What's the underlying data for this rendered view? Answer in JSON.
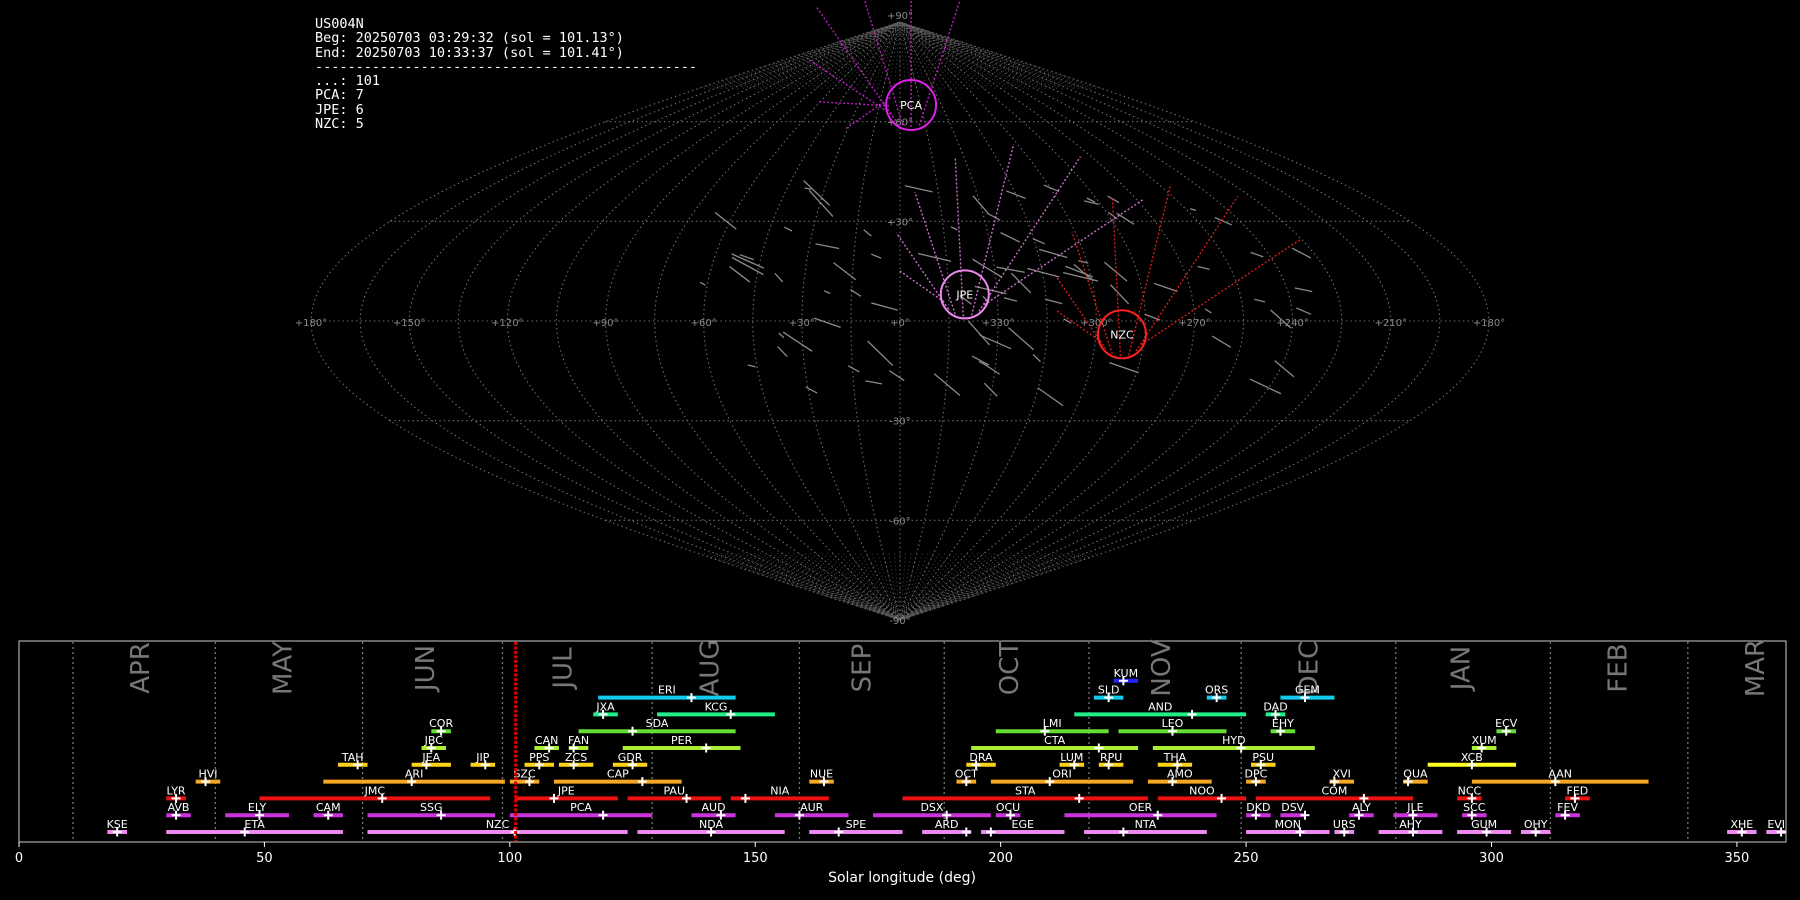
{
  "header": {
    "station": "US004N",
    "begin": "Beg: 20250703 03:29:32 (sol = 101.13°)",
    "end": "End: 20250703 10:33:37 (sol = 101.41°)",
    "separator": "-----------------------------------------------",
    "counts": [
      {
        "label": "...:",
        "value": "101"
      },
      {
        "label": "PCA:",
        "value": "7"
      },
      {
        "label": "JPE:",
        "value": "6"
      },
      {
        "label": "NZC:",
        "value": "5"
      }
    ]
  },
  "sky_map": {
    "projection": "sinusoidal",
    "lon_labels": [
      "+180°",
      "+150°",
      "+120°",
      "+90°",
      "+60°",
      "+30°",
      "+0°",
      "+330°",
      "+300°",
      "+270°",
      "+240°",
      "+210°",
      "+180°"
    ],
    "lat_labels": [
      {
        "lat": 90,
        "text": "+90°"
      },
      {
        "lat": 60,
        "text": "+60°"
      },
      {
        "lat": 30,
        "text": "+30°"
      },
      {
        "lat": -30,
        "text": "-30°"
      },
      {
        "lat": -60,
        "text": "-60°"
      },
      {
        "lat": -90,
        "text": "-90°"
      }
    ],
    "radiants": [
      {
        "code": "PCA",
        "lon": 352,
        "lat": 65,
        "color": "#e020e8"
      },
      {
        "code": "JPE",
        "lon": 340,
        "lat": 8,
        "color": "#ee88ee"
      },
      {
        "code": "NZC",
        "lon": 292,
        "lat": -4,
        "color": "#ff2020"
      }
    ]
  },
  "chart_data": {
    "type": "timeline",
    "xlabel": "Solar longitude (deg)",
    "xlim": [
      0,
      360
    ],
    "xticks": [
      0,
      50,
      100,
      150,
      200,
      250,
      300,
      350
    ],
    "current_sol": 101.2,
    "month_boundaries": [
      11,
      40,
      70,
      98.5,
      129,
      159,
      188.5,
      218,
      249,
      280.5,
      312,
      340
    ],
    "months": [
      {
        "label": "APR",
        "sol": 25
      },
      {
        "label": "MAY",
        "sol": 54
      },
      {
        "label": "JUN",
        "sol": 83
      },
      {
        "label": "JUL",
        "sol": 111
      },
      {
        "label": "AUG",
        "sol": 141
      },
      {
        "label": "SEP",
        "sol": 172
      },
      {
        "label": "OCT",
        "sol": 202
      },
      {
        "label": "NOV",
        "sol": 233
      },
      {
        "label": "DEC",
        "sol": 263
      },
      {
        "label": "JAN",
        "sol": 294
      },
      {
        "label": "FEB",
        "sol": 326
      },
      {
        "label": "MAR",
        "sol": 354
      }
    ],
    "showers": [
      {
        "code": "KSE",
        "start": 18,
        "end": 22,
        "peak": 20,
        "row": 0,
        "color": "#ee88ee"
      },
      {
        "code": "ETA",
        "start": 30,
        "end": 66,
        "peak": 46,
        "row": 0,
        "color": "#ee88ee"
      },
      {
        "code": "NZC",
        "start": 71,
        "end": 124,
        "peak": 101,
        "row": 0,
        "color": "#ee88ee"
      },
      {
        "code": "NDA",
        "start": 126,
        "end": 156,
        "peak": 141,
        "row": 0,
        "color": "#ee88ee"
      },
      {
        "code": "SPE",
        "start": 161,
        "end": 180,
        "peak": 167,
        "row": 0,
        "color": "#ee88ee"
      },
      {
        "code": "ARD",
        "start": 184,
        "end": 194,
        "peak": 193,
        "row": 0,
        "color": "#ee88ee"
      },
      {
        "code": "EGE",
        "start": 196,
        "end": 213,
        "peak": 198,
        "row": 0,
        "color": "#ee88ee"
      },
      {
        "code": "NTA",
        "start": 217,
        "end": 242,
        "peak": 225,
        "row": 0,
        "color": "#ee88ee"
      },
      {
        "code": "MON",
        "start": 250,
        "end": 267,
        "peak": 261,
        "row": 0,
        "color": "#ee88ee"
      },
      {
        "code": "URS",
        "start": 268,
        "end": 272,
        "peak": 270,
        "row": 0,
        "color": "#ee88ee"
      },
      {
        "code": "AHY",
        "start": 277,
        "end": 290,
        "peak": 284,
        "row": 0,
        "color": "#ee88ee"
      },
      {
        "code": "GUM",
        "start": 293,
        "end": 304,
        "peak": 299,
        "row": 0,
        "color": "#ee88ee"
      },
      {
        "code": "OHY",
        "start": 306,
        "end": 312,
        "peak": 309,
        "row": 0,
        "color": "#ee88ee"
      },
      {
        "code": "XHE",
        "start": 348,
        "end": 354,
        "peak": 351,
        "row": 0,
        "color": "#ee88ee"
      },
      {
        "code": "EVI",
        "start": 356,
        "end": 361,
        "peak": 359,
        "row": 0,
        "color": "#ee88ee"
      },
      {
        "code": "AVB",
        "start": 30,
        "end": 35,
        "peak": 32,
        "row": 1,
        "color": "#cc33dd"
      },
      {
        "code": "ELY",
        "start": 42,
        "end": 55,
        "peak": 49,
        "row": 1,
        "color": "#cc33dd"
      },
      {
        "code": "CAM",
        "start": 60,
        "end": 66,
        "peak": 63,
        "row": 1,
        "color": "#cc33dd"
      },
      {
        "code": "SSG",
        "start": 71,
        "end": 97,
        "peak": 86,
        "row": 1,
        "color": "#cc33dd"
      },
      {
        "code": "PCA",
        "start": 100,
        "end": 129,
        "peak": 119,
        "row": 1,
        "color": "#cc33dd"
      },
      {
        "code": "AUD",
        "start": 137,
        "end": 146,
        "peak": 143,
        "row": 1,
        "color": "#cc33dd"
      },
      {
        "code": "AUR",
        "start": 154,
        "end": 169,
        "peak": 159,
        "row": 1,
        "color": "#cc33dd"
      },
      {
        "code": "DSX",
        "start": 174,
        "end": 198,
        "peak": 189,
        "row": 1,
        "color": "#cc33dd"
      },
      {
        "code": "OCU",
        "start": 199,
        "end": 204,
        "peak": 202,
        "row": 1,
        "color": "#cc33dd"
      },
      {
        "code": "OER",
        "start": 213,
        "end": 244,
        "peak": 232,
        "row": 1,
        "color": "#cc33dd"
      },
      {
        "code": "DKD",
        "start": 250,
        "end": 255,
        "peak": 252,
        "row": 1,
        "color": "#cc33dd"
      },
      {
        "code": "DSV",
        "start": 257,
        "end": 262,
        "peak": 262,
        "row": 1,
        "color": "#cc33dd"
      },
      {
        "code": "ALY",
        "start": 271,
        "end": 276,
        "peak": 273,
        "row": 1,
        "color": "#cc33dd"
      },
      {
        "code": "JLE",
        "start": 280,
        "end": 289,
        "peak": 284,
        "row": 1,
        "color": "#cc33dd"
      },
      {
        "code": "SCC",
        "start": 294,
        "end": 299,
        "peak": 296,
        "row": 1,
        "color": "#cc33dd"
      },
      {
        "code": "FEV",
        "start": 313,
        "end": 318,
        "peak": 315,
        "row": 1,
        "color": "#cc33dd"
      },
      {
        "code": "LYR",
        "start": 30,
        "end": 34,
        "peak": 32,
        "row": 2,
        "color": "#ee1111"
      },
      {
        "code": "JMC",
        "start": 49,
        "end": 96,
        "peak": 74,
        "row": 2,
        "color": "#ee1111"
      },
      {
        "code": "JPE",
        "start": 101,
        "end": 122,
        "peak": 109,
        "row": 2,
        "color": "#ee1111"
      },
      {
        "code": "PAU",
        "start": 124,
        "end": 143,
        "peak": 136,
        "row": 2,
        "color": "#ee1111"
      },
      {
        "code": "NIA",
        "start": 145,
        "end": 165,
        "peak": 148,
        "row": 2,
        "color": "#ee1111"
      },
      {
        "code": "STA",
        "start": 180,
        "end": 230,
        "peak": 216,
        "row": 2,
        "color": "#ee1111"
      },
      {
        "code": "NOO",
        "start": 232,
        "end": 250,
        "peak": 245,
        "row": 2,
        "color": "#ee1111"
      },
      {
        "code": "COM",
        "start": 252,
        "end": 284,
        "peak": 274,
        "row": 2,
        "color": "#ee1111"
      },
      {
        "code": "NCC",
        "start": 293,
        "end": 298,
        "peak": 296,
        "row": 2,
        "color": "#ee1111"
      },
      {
        "code": "FED",
        "start": 315,
        "end": 320,
        "peak": 317,
        "row": 2,
        "color": "#ee1111"
      },
      {
        "code": "HVI",
        "start": 36,
        "end": 41,
        "peak": 38,
        "row": 3,
        "color": "#f5a623"
      },
      {
        "code": "ARI",
        "start": 62,
        "end": 99,
        "peak": 80,
        "row": 3,
        "color": "#f5a623"
      },
      {
        "code": "SZC",
        "start": 100,
        "end": 106,
        "peak": 104,
        "row": 3,
        "color": "#f5a623"
      },
      {
        "code": "CAP",
        "start": 109,
        "end": 135,
        "peak": 127,
        "row": 3,
        "color": "#f5a623"
      },
      {
        "code": "NUE",
        "start": 161,
        "end": 166,
        "peak": 164,
        "row": 3,
        "color": "#f5a623"
      },
      {
        "code": "OCT",
        "start": 191,
        "end": 195,
        "peak": 193,
        "row": 3,
        "color": "#f5a623"
      },
      {
        "code": "ORI",
        "start": 198,
        "end": 227,
        "peak": 210,
        "row": 3,
        "color": "#f5a623"
      },
      {
        "code": "AMO",
        "start": 230,
        "end": 243,
        "peak": 235,
        "row": 3,
        "color": "#f5a623"
      },
      {
        "code": "DPC",
        "start": 250,
        "end": 254,
        "peak": 252,
        "row": 3,
        "color": "#f5a623"
      },
      {
        "code": "XVI",
        "start": 267,
        "end": 272,
        "peak": 268,
        "row": 3,
        "color": "#f5a623"
      },
      {
        "code": "QUA",
        "start": 282,
        "end": 287,
        "peak": 283,
        "row": 3,
        "color": "#f5a623"
      },
      {
        "code": "AAN",
        "start": 296,
        "end": 332,
        "peak": 313,
        "row": 3,
        "color": "#f5a623"
      },
      {
        "code": "TAH",
        "start": 65,
        "end": 71,
        "peak": 69,
        "row": 4,
        "color": "#ffd21a"
      },
      {
        "code": "JEA",
        "start": 80,
        "end": 88,
        "peak": 83,
        "row": 4,
        "color": "#ffd21a"
      },
      {
        "code": "JIP",
        "start": 92,
        "end": 97,
        "peak": 95,
        "row": 4,
        "color": "#ffd21a"
      },
      {
        "code": "PPS",
        "start": 103,
        "end": 109,
        "peak": 106,
        "row": 4,
        "color": "#ffd21a"
      },
      {
        "code": "ZCS",
        "start": 110,
        "end": 117,
        "peak": 113,
        "row": 4,
        "color": "#ffd21a"
      },
      {
        "code": "GDR",
        "start": 121,
        "end": 128,
        "peak": 125,
        "row": 4,
        "color": "#ffd21a"
      },
      {
        "code": "DRA",
        "start": 193,
        "end": 199,
        "peak": 195,
        "row": 4,
        "color": "#ffd21a"
      },
      {
        "code": "LUM",
        "start": 212,
        "end": 217,
        "peak": 215,
        "row": 4,
        "color": "#ffd21a"
      },
      {
        "code": "RPU",
        "start": 220,
        "end": 225,
        "peak": 222,
        "row": 4,
        "color": "#ffd21a"
      },
      {
        "code": "THA",
        "start": 232,
        "end": 239,
        "peak": 236,
        "row": 4,
        "color": "#ffd21a"
      },
      {
        "code": "PSU",
        "start": 251,
        "end": 256,
        "peak": 253,
        "row": 4,
        "color": "#ffd21a"
      },
      {
        "code": "XCB",
        "start": 287,
        "end": 305,
        "peak": 296,
        "row": 4,
        "color": "#ffff22"
      },
      {
        "code": "JBC",
        "start": 82,
        "end": 87,
        "peak": 84,
        "row": 5,
        "color": "#aaee33"
      },
      {
        "code": "CAN",
        "start": 105,
        "end": 110,
        "peak": 108,
        "row": 5,
        "color": "#aaee33"
      },
      {
        "code": "FAN",
        "start": 112,
        "end": 116,
        "peak": 113,
        "row": 5,
        "color": "#aaee33"
      },
      {
        "code": "PER",
        "start": 123,
        "end": 147,
        "peak": 140,
        "row": 5,
        "color": "#aaee33"
      },
      {
        "code": "CTA",
        "start": 194,
        "end": 228,
        "peak": 220,
        "row": 5,
        "color": "#aaee33"
      },
      {
        "code": "HYD",
        "start": 231,
        "end": 264,
        "peak": 249,
        "row": 5,
        "color": "#aaee33"
      },
      {
        "code": "XUM",
        "start": 296,
        "end": 301,
        "peak": 298,
        "row": 5,
        "color": "#aaee33"
      },
      {
        "code": "COR",
        "start": 84,
        "end": 88,
        "peak": 86,
        "row": 6,
        "color": "#66dd33"
      },
      {
        "code": "SDA",
        "start": 114,
        "end": 146,
        "peak": 125,
        "row": 6,
        "color": "#66dd33"
      },
      {
        "code": "LMI",
        "start": 199,
        "end": 222,
        "peak": 209,
        "row": 6,
        "color": "#66dd33"
      },
      {
        "code": "LEO",
        "start": 224,
        "end": 246,
        "peak": 235,
        "row": 6,
        "color": "#66dd33"
      },
      {
        "code": "EHY",
        "start": 255,
        "end": 260,
        "peak": 257,
        "row": 6,
        "color": "#66dd33"
      },
      {
        "code": "ECV",
        "start": 301,
        "end": 305,
        "peak": 303,
        "row": 6,
        "color": "#66dd33"
      },
      {
        "code": "JXA",
        "start": 117,
        "end": 122,
        "peak": 119,
        "row": 7,
        "color": "#22ee88"
      },
      {
        "code": "KCG",
        "start": 130,
        "end": 154,
        "peak": 145,
        "row": 7,
        "color": "#22ee88"
      },
      {
        "code": "AND",
        "start": 215,
        "end": 250,
        "peak": 239,
        "row": 7,
        "color": "#22ee88"
      },
      {
        "code": "DAD",
        "start": 254,
        "end": 258,
        "peak": 256,
        "row": 7,
        "color": "#22ee88"
      },
      {
        "code": "ERI",
        "start": 118,
        "end": 146,
        "peak": 137,
        "row": 8,
        "color": "#11ccee"
      },
      {
        "code": "SLD",
        "start": 219,
        "end": 225,
        "peak": 222,
        "row": 8,
        "color": "#11ccee"
      },
      {
        "code": "ORS",
        "start": 242,
        "end": 246,
        "peak": 244,
        "row": 8,
        "color": "#11ccee"
      },
      {
        "code": "GEM",
        "start": 257,
        "end": 268,
        "peak": 262,
        "row": 8,
        "color": "#11ccee"
      },
      {
        "code": "KUM",
        "start": 223,
        "end": 228,
        "peak": 225,
        "row": 9,
        "color": "#2222ff"
      }
    ]
  }
}
